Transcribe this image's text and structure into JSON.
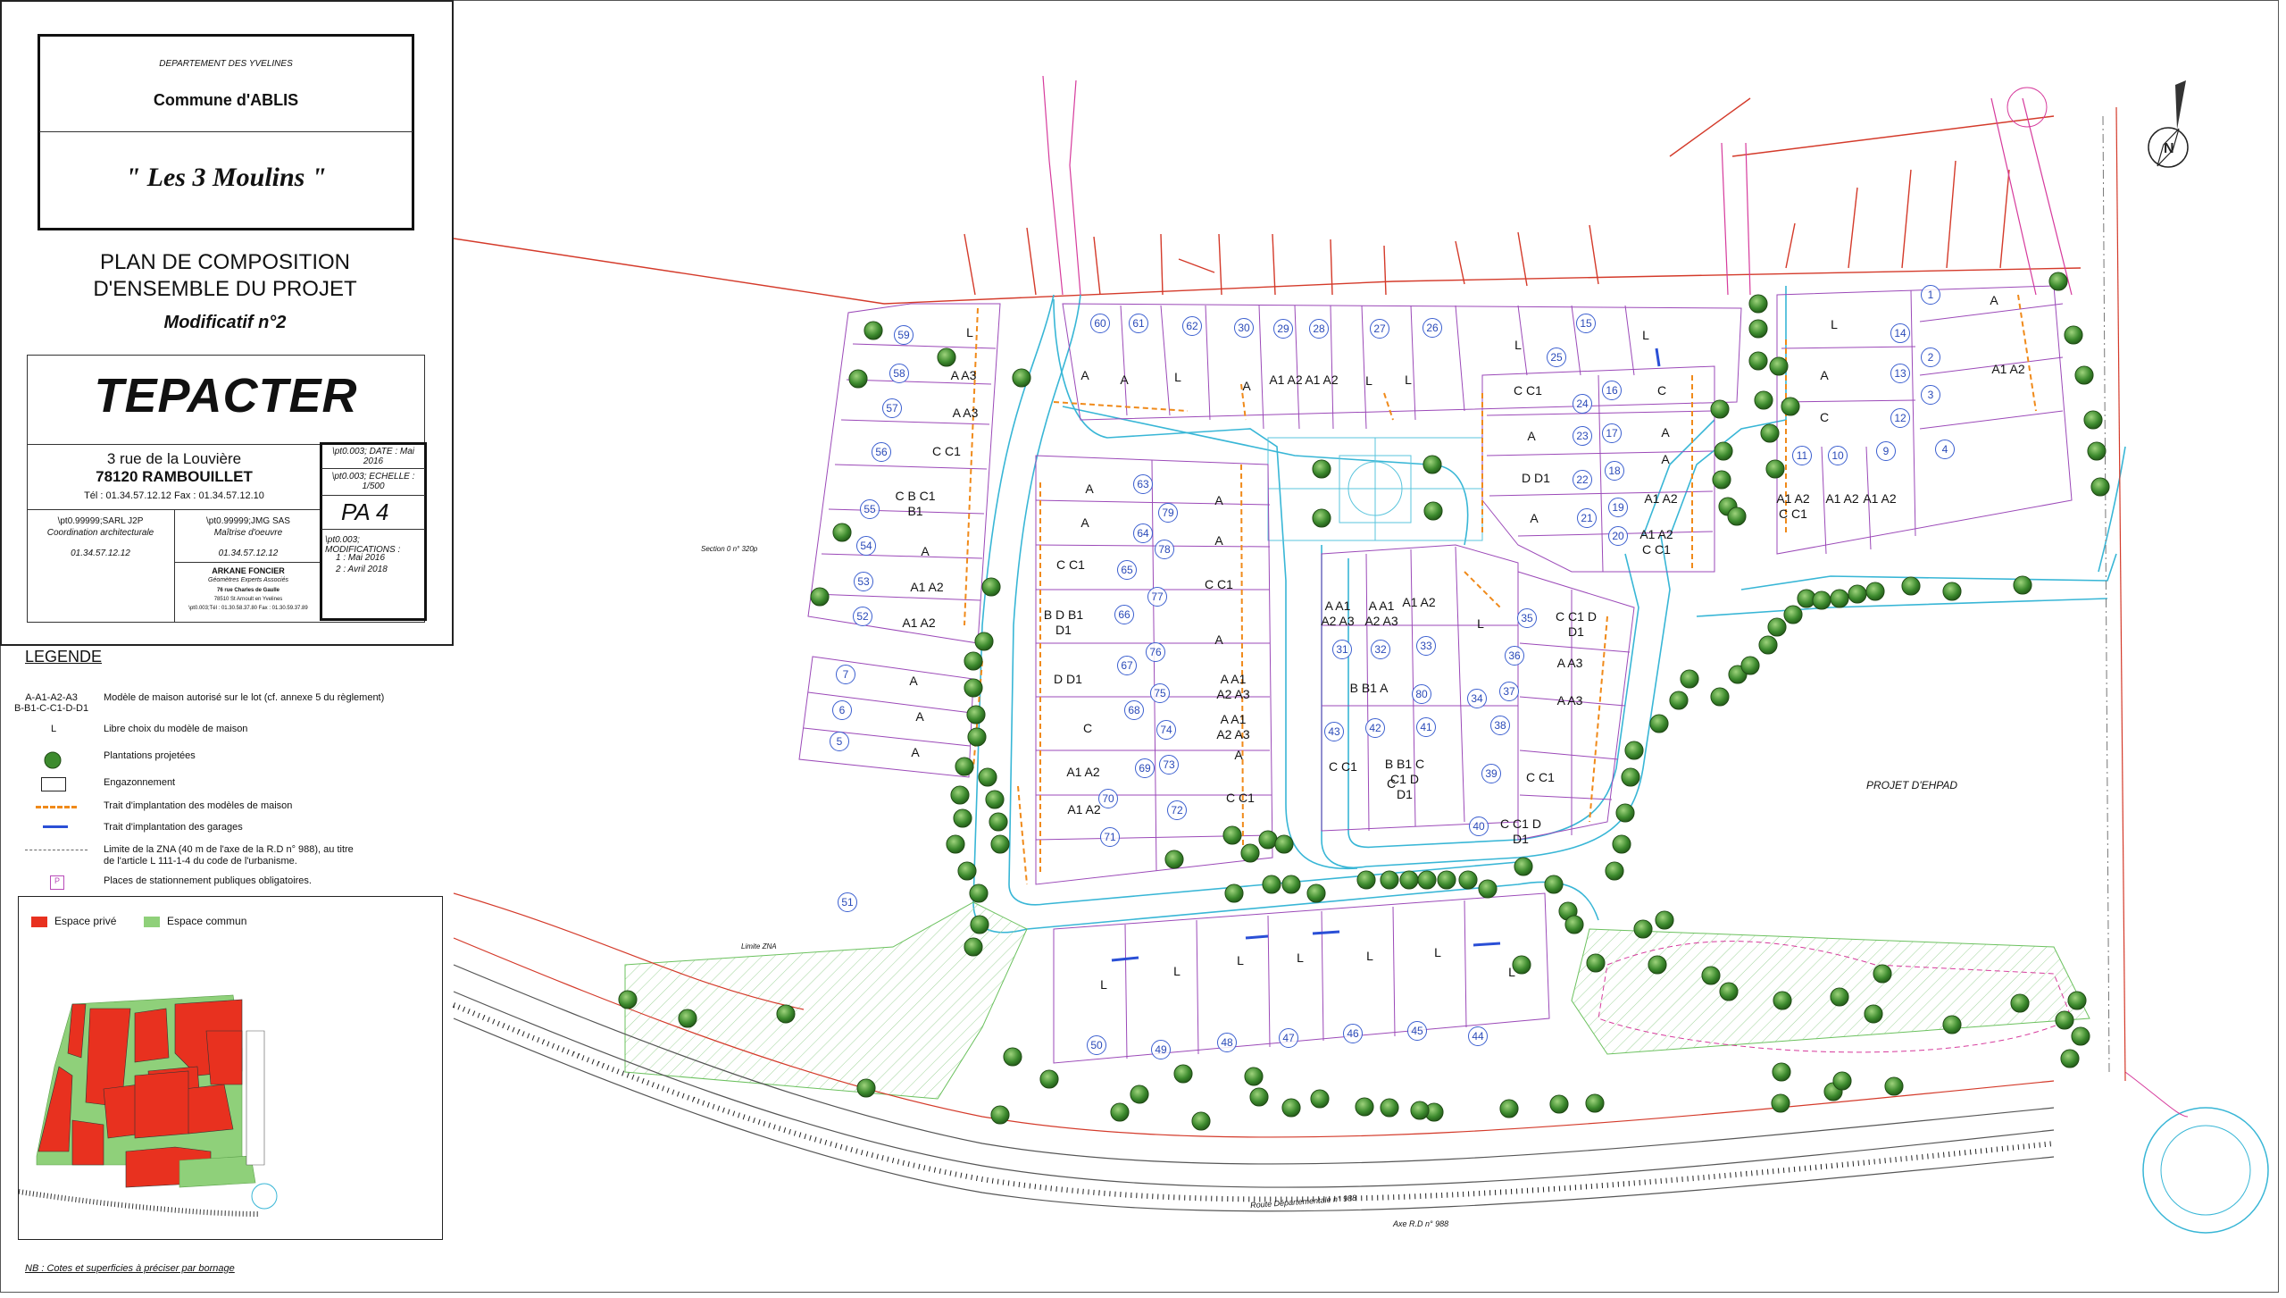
{
  "cartouche": {
    "department": "DEPARTEMENT DES YVELINES",
    "commune": "Commune d'ABLIS",
    "project_name": "\" Les 3 Moulins \"",
    "plan_title_1": "PLAN DE COMPOSITION",
    "plan_title_2": "D'ENSEMBLE DU PROJET",
    "modificatif": "Modificatif n°2",
    "company": "TEPACTER",
    "address_1": "3 rue de la Louvière",
    "address_2": "78120 RAMBOUILLET",
    "tel_fax": "Tél : 01.34.57.12.12     Fax : 01.34.57.12.10",
    "date_label": "\\pt0.003; DATE : Mai 2016",
    "scale_label": "\\pt0.003; ECHELLE : 1/500",
    "coord_1": "\\pt0.99999;SARL J2P",
    "coord_2": "Coordination architecturale",
    "coord_tel": "01.34.57.12.12",
    "moe_1": "\\pt0.99999;JMG SAS",
    "moe_2": "Maîtrise d'oeuvre",
    "moe_tel": "01.34.57.12.12",
    "arkane": "ARKANE FONCIER",
    "arkane_2": "Géomètres Experts Associés",
    "arkane_3": "76 rue Charles de Gaulle",
    "arkane_4": "78510 St Arnoult en Yvelines",
    "arkane_5": "\\pt0.003;Tél : 01.30.58.37.80  Fax : 01.30.59.37.89",
    "pa": "PA 4",
    "modif_title": "\\pt0.003; MODIFICATIONS :",
    "modif_1": "1 : Mai 2016",
    "modif_2": "2 : Avril 2018"
  },
  "legend": {
    "title": "LEGENDE",
    "items": [
      {
        "key": "A-A1-A2-A3\nB-B1-C-C1-D-D1",
        "text": "Modèle de maison autorisé sur le lot (cf. annexe 5 du règlement)"
      },
      {
        "key": "L",
        "text": "Libre choix du modèle de maison"
      },
      {
        "key": "tree",
        "text": "Plantations projetées"
      },
      {
        "key": "lawn",
        "text": "Engazonnement"
      },
      {
        "key": "orange-dash",
        "text": "Trait d'implantation des modèles de maison"
      },
      {
        "key": "blue-bar",
        "text": "Trait d'implantation des garages"
      },
      {
        "key": "dashdot",
        "text": "Limite de la ZNA (40 m de l'axe de la R.D n° 988), au titre\nde l'article L 111-1-4 du code de l'urbanisme."
      },
      {
        "key": "parking",
        "text": "Places de stationnement publiques obligatoires."
      }
    ]
  },
  "inset": {
    "private_label": "Espace privé",
    "common_label": "Espace commun",
    "colors": {
      "private": "#e8311f",
      "common": "#8fd07a"
    }
  },
  "footnote": "NB : Cotes et superficies à préciser par bornage",
  "map_labels": {
    "ehpad": "PROJET D'EHPAD",
    "route": "Route Départementale n° 988",
    "axe": "Axe R.D n° 988",
    "section": "Section 0 n° 320p",
    "limite": "Limite ZNA"
  },
  "lots": [
    {
      "n": "59",
      "letters": "L"
    },
    {
      "n": "58",
      "letters": "A A3"
    },
    {
      "n": "57",
      "letters": "A A3"
    },
    {
      "n": "56",
      "letters": "C C1"
    },
    {
      "n": "55",
      "letters": "C B C1 B1"
    },
    {
      "n": "54",
      "letters": "A"
    },
    {
      "n": "53",
      "letters": "A1 A2"
    },
    {
      "n": "52",
      "letters": "A1 A2"
    },
    {
      "n": "7",
      "letters": "A"
    },
    {
      "n": "6",
      "letters": "A"
    },
    {
      "n": "5",
      "letters": "A"
    },
    {
      "n": "51",
      "letters": ""
    },
    {
      "n": "60",
      "letters": "A"
    },
    {
      "n": "61",
      "letters": "A"
    },
    {
      "n": "62",
      "letters": "L"
    },
    {
      "n": "30",
      "letters": "A"
    },
    {
      "n": "29",
      "letters": "A1 A2"
    },
    {
      "n": "28",
      "letters": "A1 A2"
    },
    {
      "n": "27",
      "letters": "L"
    },
    {
      "n": "26",
      "letters": "L"
    },
    {
      "n": "25",
      "letters": "L"
    },
    {
      "n": "15",
      "letters": "L"
    },
    {
      "n": "24",
      "letters": "C C1"
    },
    {
      "n": "16",
      "letters": "C"
    },
    {
      "n": "23",
      "letters": "A"
    },
    {
      "n": "17",
      "letters": "A"
    },
    {
      "n": "22",
      "letters": "D D1"
    },
    {
      "n": "18",
      "letters": "A"
    },
    {
      "n": "21",
      "letters": "A"
    },
    {
      "n": "19",
      "letters": "A1 A2"
    },
    {
      "n": "20",
      "letters": "A1 A2 C C1"
    },
    {
      "n": "1",
      "letters": "A"
    },
    {
      "n": "14",
      "letters": "L"
    },
    {
      "n": "2",
      "letters": "A1 A2"
    },
    {
      "n": "13",
      "letters": "A"
    },
    {
      "n": "3",
      "letters": ""
    },
    {
      "n": "12",
      "letters": "C"
    },
    {
      "n": "4",
      "letters": ""
    },
    {
      "n": "11",
      "letters": "A1 A2 C C1"
    },
    {
      "n": "10",
      "letters": "A1 A2"
    },
    {
      "n": "9",
      "letters": "A1 A2"
    },
    {
      "n": "63",
      "letters": "A"
    },
    {
      "n": "79",
      "letters": "A"
    },
    {
      "n": "64",
      "letters": "A"
    },
    {
      "n": "78",
      "letters": "A"
    },
    {
      "n": "65",
      "letters": "C C1"
    },
    {
      "n": "77",
      "letters": "C C1"
    },
    {
      "n": "66",
      "letters": "B D B1 D1"
    },
    {
      "n": "76",
      "letters": "A"
    },
    {
      "n": "67",
      "letters": "D D1"
    },
    {
      "n": "75",
      "letters": "A A1 A2 A3"
    },
    {
      "n": "68",
      "letters": "C"
    },
    {
      "n": "74",
      "letters": "A A1 A2 A3"
    },
    {
      "n": "69",
      "letters": "A1 A2"
    },
    {
      "n": "73",
      "letters": "A"
    },
    {
      "n": "70",
      "letters": "A1 A2"
    },
    {
      "n": "72",
      "letters": "C C1"
    },
    {
      "n": "71",
      "letters": ""
    },
    {
      "n": "31",
      "letters": "A A1 A2 A3"
    },
    {
      "n": "32",
      "letters": "A A1 A2 A3"
    },
    {
      "n": "33",
      "letters": "A1 A2"
    },
    {
      "n": "80",
      "letters": "B B1 A"
    },
    {
      "n": "43",
      "letters": "C C1"
    },
    {
      "n": "42",
      "letters": "C"
    },
    {
      "n": "41",
      "letters": "B B1 C C1 D D1"
    },
    {
      "n": "35",
      "letters": "L"
    },
    {
      "n": "36",
      "letters": "C C1 D D1"
    },
    {
      "n": "37",
      "letters": "A A3"
    },
    {
      "n": "34",
      "letters": "A A3"
    },
    {
      "n": "38",
      "letters": ""
    },
    {
      "n": "39",
      "letters": "C C1"
    },
    {
      "n": "40",
      "letters": "C C1 D D1"
    },
    {
      "n": "50",
      "letters": "L"
    },
    {
      "n": "49",
      "letters": "L"
    },
    {
      "n": "48",
      "letters": "L"
    },
    {
      "n": "47",
      "letters": "L"
    },
    {
      "n": "46",
      "letters": "L"
    },
    {
      "n": "45",
      "letters": "L"
    },
    {
      "n": "44",
      "letters": "L"
    }
  ]
}
